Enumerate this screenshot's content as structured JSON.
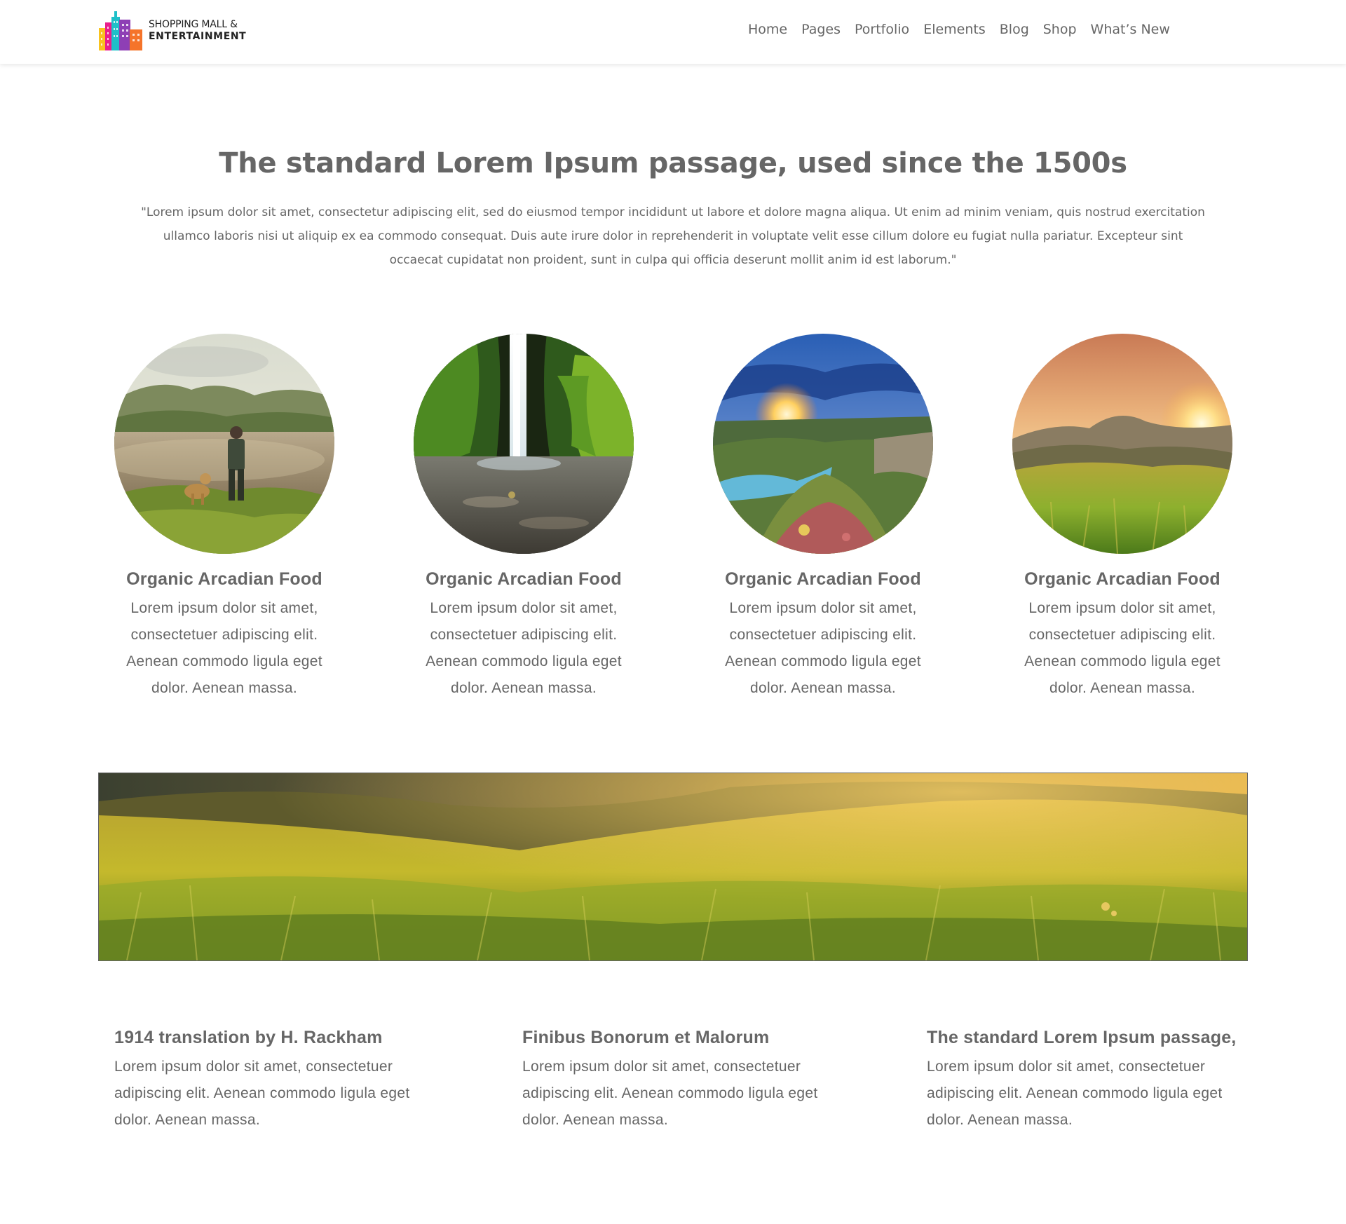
{
  "brand": {
    "name_line1": "SHOPPING MALL &",
    "name_line2": "ENTERTAINMENT",
    "colors": [
      "#f9c31f",
      "#e91e8c",
      "#1ec0c9",
      "#8e3fb5",
      "#f5742a"
    ]
  },
  "nav": {
    "items": [
      {
        "label": "Home"
      },
      {
        "label": "Pages"
      },
      {
        "label": "Portfolio"
      },
      {
        "label": "Elements"
      },
      {
        "label": "Blog"
      },
      {
        "label": "Shop"
      },
      {
        "label": "What’s New"
      }
    ]
  },
  "intro": {
    "title": "The standard Lorem Ipsum passage, used since the 1500s",
    "text": "\"Lorem ipsum dolor sit amet, consectetur adipiscing elit, sed do eiusmod tempor incididunt ut labore et dolore magna aliqua. Ut enim ad minim veniam, quis nostrud exercitation ullamco laboris nisi ut aliquip ex ea commodo consequat. Duis aute irure dolor in reprehenderit in voluptate velit esse cillum dolore eu fugiat nulla pariatur. Excepteur sint occaecat cupidatat non proident, sunt in culpa qui officia deserunt mollit anim id est laborum.\""
  },
  "features": [
    {
      "image": "hiker-with-dog-by-lake",
      "title": "Organic Arcadian Food",
      "text": "Lorem ipsum dolor sit amet, consectetuer adipiscing elit. Aenean commodo ligula eget dolor. Aenean massa."
    },
    {
      "image": "waterfall-in-mossy-gorge",
      "title": "Organic Arcadian Food",
      "text": "Lorem ipsum dolor sit amet, consectetuer adipiscing elit. Aenean commodo ligula eget dolor. Aenean massa."
    },
    {
      "image": "sunset-over-valley",
      "title": "Organic Arcadian Food",
      "text": "Lorem ipsum dolor sit amet, consectetuer adipiscing elit. Aenean commodo ligula eget dolor. Aenean massa."
    },
    {
      "image": "golden-meadow-sunset",
      "title": "Organic Arcadian Food",
      "text": "Lorem ipsum dolor sit amet, consectetuer adipiscing elit. Aenean commodo ligula eget dolor. Aenean massa."
    }
  ],
  "banner": {
    "image": "grassy-hillside-panorama"
  },
  "columns": [
    {
      "title": "1914 translation by H. Rackham",
      "text": "Lorem ipsum dolor sit amet, consectetuer adipiscing elit. Aenean commodo ligula eget dolor. Aenean massa."
    },
    {
      "title": "Finibus Bonorum et Malorum",
      "text": "Lorem ipsum dolor sit amet, consectetuer adipiscing elit. Aenean commodo ligula eget dolor. Aenean massa."
    },
    {
      "title": "The standard Lorem Ipsum passage,",
      "text": "Lorem ipsum dolor sit amet, consectetuer adipiscing elit. Aenean commodo ligula eget dolor. Aenean massa."
    }
  ]
}
